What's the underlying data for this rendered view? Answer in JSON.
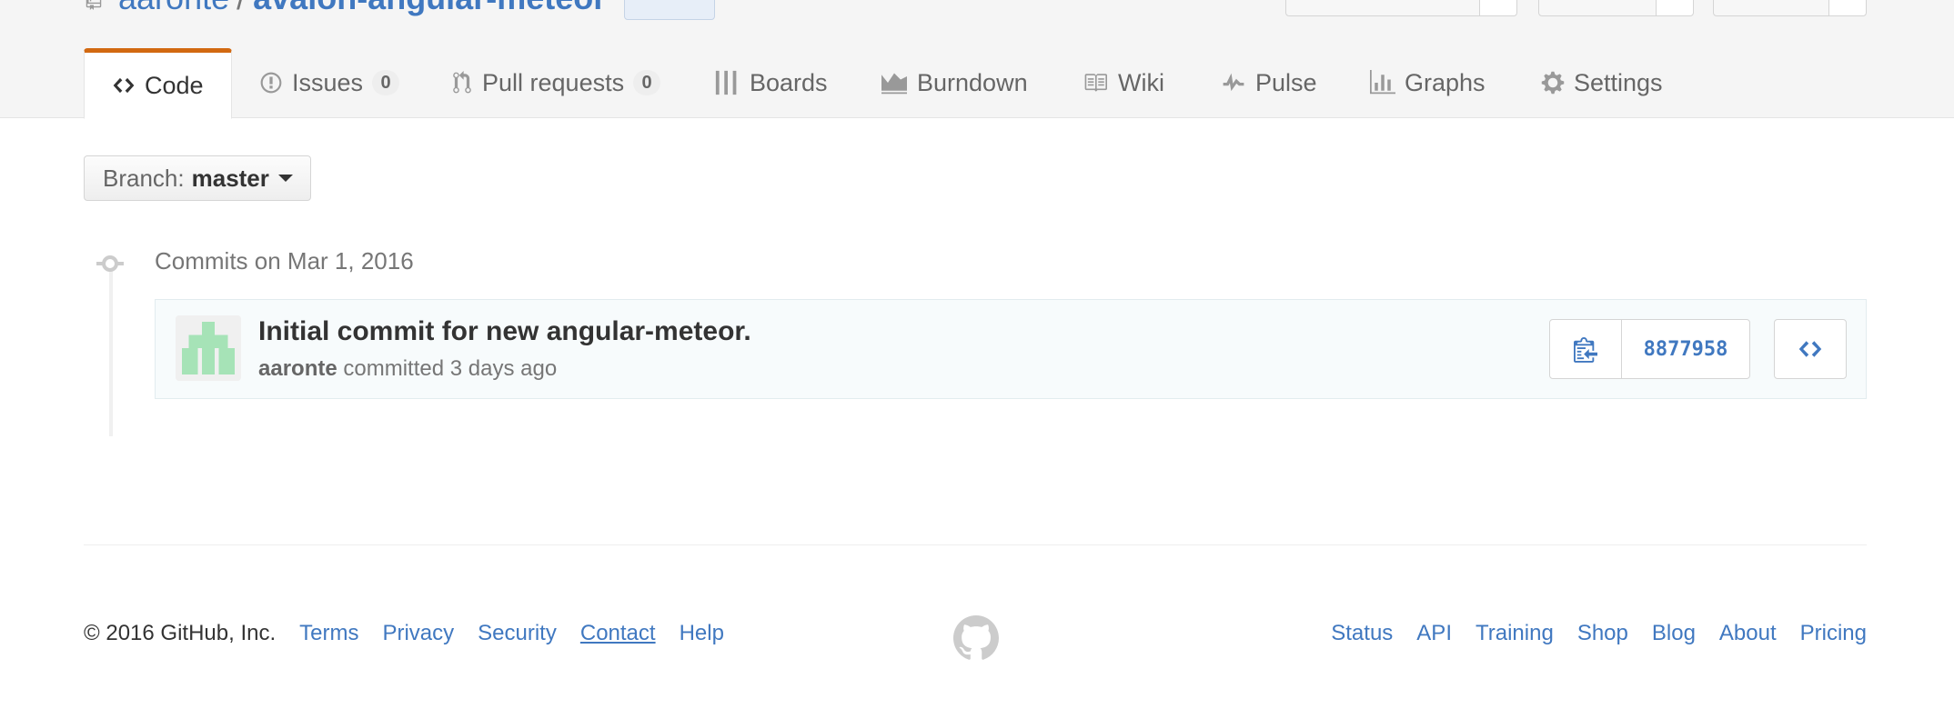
{
  "repo": {
    "owner": "aaronte",
    "separator": "/",
    "name": "avalon-angular-meteor"
  },
  "tabs": [
    {
      "label": "Code",
      "icon": "code-icon",
      "selected": true
    },
    {
      "label": "Issues",
      "icon": "issue-opened-icon",
      "count": "0"
    },
    {
      "label": "Pull requests",
      "icon": "git-pull-request-icon",
      "count": "0"
    },
    {
      "label": "Boards",
      "icon": "boards-icon"
    },
    {
      "label": "Burndown",
      "icon": "burndown-icon"
    },
    {
      "label": "Wiki",
      "icon": "book-icon"
    },
    {
      "label": "Pulse",
      "icon": "pulse-icon"
    },
    {
      "label": "Graphs",
      "icon": "graph-icon"
    },
    {
      "label": "Settings",
      "icon": "gear-icon"
    }
  ],
  "branch": {
    "prefix": "Branch:",
    "name": "master"
  },
  "commits": {
    "group_title": "Commits on Mar 1, 2016",
    "items": [
      {
        "title": "Initial commit for new angular-meteor.",
        "author": "aaronte",
        "action": "committed",
        "time": "3 days ago",
        "sha": "8877958"
      }
    ]
  },
  "footer": {
    "copyright": "© 2016 GitHub, Inc.",
    "left_links": [
      "Terms",
      "Privacy",
      "Security",
      "Contact",
      "Help"
    ],
    "right_links": [
      "Status",
      "API",
      "Training",
      "Shop",
      "Blog",
      "About",
      "Pricing"
    ]
  },
  "colors": {
    "link": "#4078c0",
    "selected_tab_accent": "#d26911",
    "avatar_identicon": "#a6e3b7"
  }
}
